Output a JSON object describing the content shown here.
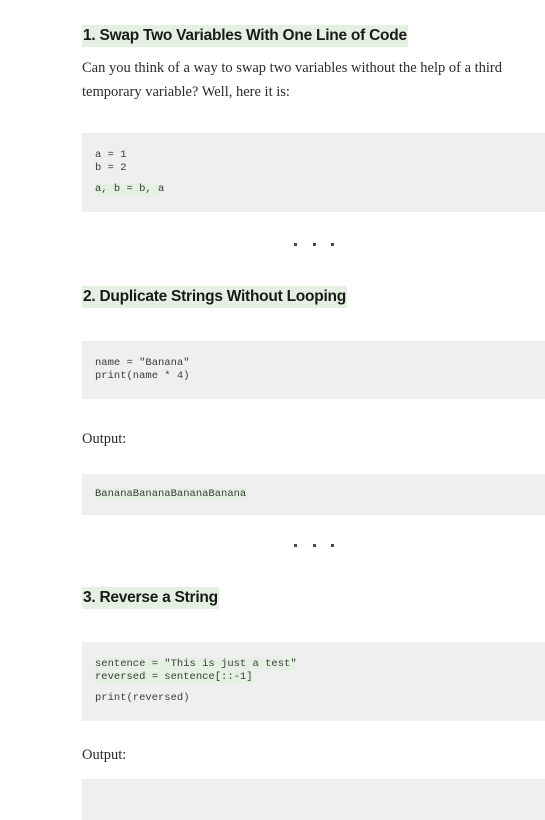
{
  "document": {
    "type": "article-excerpt",
    "theme": {
      "page_background": "#ffffff",
      "code_background": "#efefef",
      "highlight_green": "#e4f1e2",
      "heading_color": "#1a1a1a",
      "body_color": "#2b2b2b",
      "code_color": "#3b3b3b",
      "dot_color": "#4a4a4a"
    }
  },
  "sections": [
    {
      "number": "1.",
      "heading": "1. Swap Two Variables With One Line of Code",
      "paragraph": "Can you think of a way to swap two variables without the help of a third temporary variable? Well, here it is:",
      "code": {
        "lines": [
          {
            "text": "a = 1",
            "highlight": false
          },
          {
            "text": "b = 2",
            "highlight": false
          },
          {
            "text": "",
            "highlight": false
          },
          {
            "text": "a, b = b, a",
            "highlight": true
          }
        ]
      }
    },
    {
      "number": "2.",
      "heading": "2. Duplicate Strings Without Looping",
      "code": {
        "lines": [
          {
            "text": "name = \"Banana\"",
            "highlight": false
          },
          {
            "text": "print(name * 4)",
            "highlight": false
          }
        ]
      },
      "output_label": "Output:",
      "output": "BananaBananaBananaBanana"
    },
    {
      "number": "3.",
      "heading": "3. Reverse a String",
      "code": {
        "lines": [
          {
            "text": "sentence = \"This is just a test\"",
            "highlight": true
          },
          {
            "text": "reversed = sentence[::-1]",
            "highlight": true
          },
          {
            "text": "",
            "highlight": false
          },
          {
            "text": "print(reversed)",
            "highlight": false
          }
        ]
      },
      "output_label": "Output:"
    }
  ],
  "separator": {
    "glyph": "dot",
    "count": 3
  }
}
